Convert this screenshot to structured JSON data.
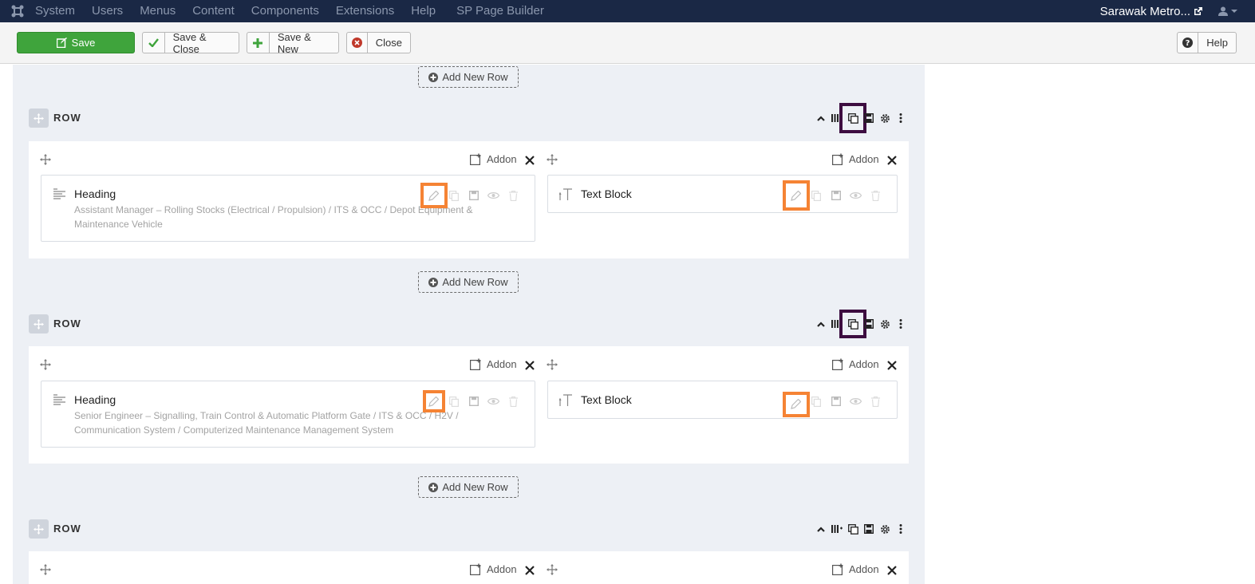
{
  "nav": {
    "items": [
      "System",
      "Users",
      "Menus",
      "Content",
      "Components",
      "Extensions",
      "Help",
      "SP Page Builder"
    ],
    "site_name": "Sarawak Metro...",
    "icons": {
      "logo": "joomla-logo-icon",
      "external": "external-link-icon",
      "user": "user-icon"
    }
  },
  "toolbar": {
    "save": "Save",
    "save_close": "Save & Close",
    "save_new": "Save & New",
    "close": "Close",
    "help": "Help"
  },
  "builder": {
    "add_row_label": "Add New Row",
    "row_label": "ROW",
    "addon_label": "Addon",
    "rows": [
      {
        "columns": [
          {
            "addon_title": "Heading",
            "addon_subtitle": "Assistant Manager – Rolling Stocks (Electrical / Propulsion) / ITS & OCC / Depot Equipment & Maintenance Vehicle"
          },
          {
            "addon_title": "Text Block",
            "addon_subtitle": ""
          }
        ]
      },
      {
        "columns": [
          {
            "addon_title": "Heading",
            "addon_subtitle": "Senior Engineer – Signalling, Train Control & Automatic Platform Gate / ITS & OCC / H2V / Communication System / Computerized Maintenance Management System"
          },
          {
            "addon_title": "Text Block",
            "addon_subtitle": ""
          }
        ]
      }
    ]
  },
  "colors": {
    "nav_bg": "#1a2845",
    "save_green": "#3fa43c",
    "highlight_orange": "#f58334",
    "highlight_purple": "#3d0d40",
    "canvas_bg": "#edf0f5"
  }
}
